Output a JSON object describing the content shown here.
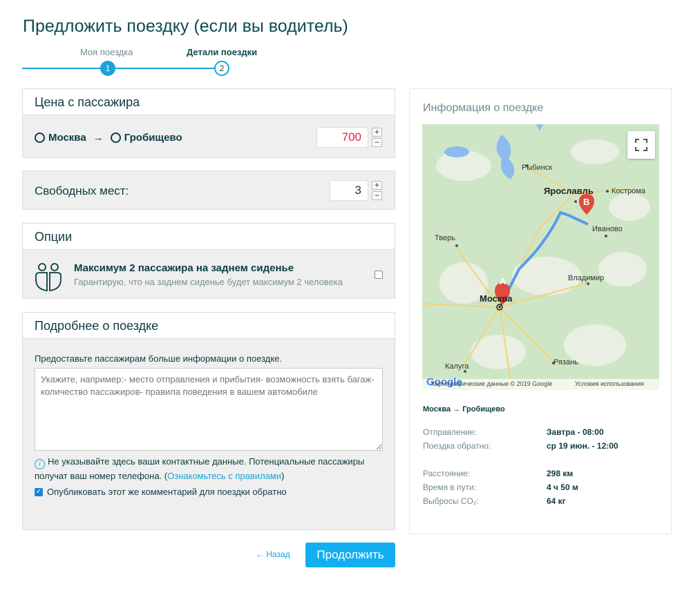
{
  "page": {
    "title": "Предложить поездку (если вы водитель)"
  },
  "stepper": {
    "steps": [
      {
        "label": "Моя поездка",
        "number": "1"
      },
      {
        "label": "Детали поездки",
        "number": "2"
      }
    ]
  },
  "price": {
    "header": "Цена с пассажира",
    "from": "Москва",
    "arrow": "→",
    "to": "Гробищево",
    "value": "700",
    "plus": "+",
    "minus": "−"
  },
  "seats": {
    "label": "Свободных мест:",
    "value": "3",
    "plus": "+",
    "minus": "−"
  },
  "options": {
    "header": "Опции",
    "item_title": "Максимум 2 пассажира на заднем сиденье",
    "item_subtitle": "Гарантирую, что на заднем сиденье будет максимум 2 человека",
    "icon": "two-passengers-icon"
  },
  "details": {
    "header": "Подробнее о поездке",
    "hint": "Предоставьте пассажирам больше информации о поездке.",
    "placeholder": "Укажите, например:- место отправления и прибытия- возможность взять багаж- количество пассажиров- правила поведения в вашем автомобиле",
    "warning": "Не указывайте здесь ваши контактные данные. Потенциальные пассажиры получат ваш номер телефона. (",
    "rules_link": "Ознакомьтесь с правилами",
    "warning_end": ")",
    "info_glyph": "i",
    "checkbox_label": "Опубликовать этот же комментарий для поездки обратно",
    "checkbox_checked": true
  },
  "nav": {
    "back": "← Назад",
    "continue": "Продолжить"
  },
  "trip_info": {
    "title": "Информация о поездке",
    "route": "Москва → Гробищево",
    "rows": [
      {
        "key": "Отправление:",
        "value": "Завтра - 08:00"
      },
      {
        "key": "Поездка обратно:",
        "value": "ср 19 июн. - 12:00"
      },
      {
        "key": "Расстояние:",
        "value": "298 км"
      },
      {
        "key": "Время в пути:",
        "value": "4 ч 50 м"
      },
      {
        "key": "Выбросы CO₂:",
        "value": "64 кг"
      }
    ]
  },
  "map": {
    "cities": {
      "rybinsk": "Рыбинск",
      "yaroslavl": "Ярославль",
      "kostroma": "Кострома",
      "ivanovo": "Иваново",
      "tver": "Тверь",
      "vladimir": "Владимир",
      "moscow": "Москва",
      "kaluga": "Калуга",
      "ryazan": "Рязань"
    },
    "marker_a": "A",
    "marker_b": "B",
    "copyright": "Картографические данные © 2019 Google",
    "terms": "Условия использования",
    "google": "Google",
    "accent": "#1aa3d9",
    "route_color": "#5a9be8"
  }
}
